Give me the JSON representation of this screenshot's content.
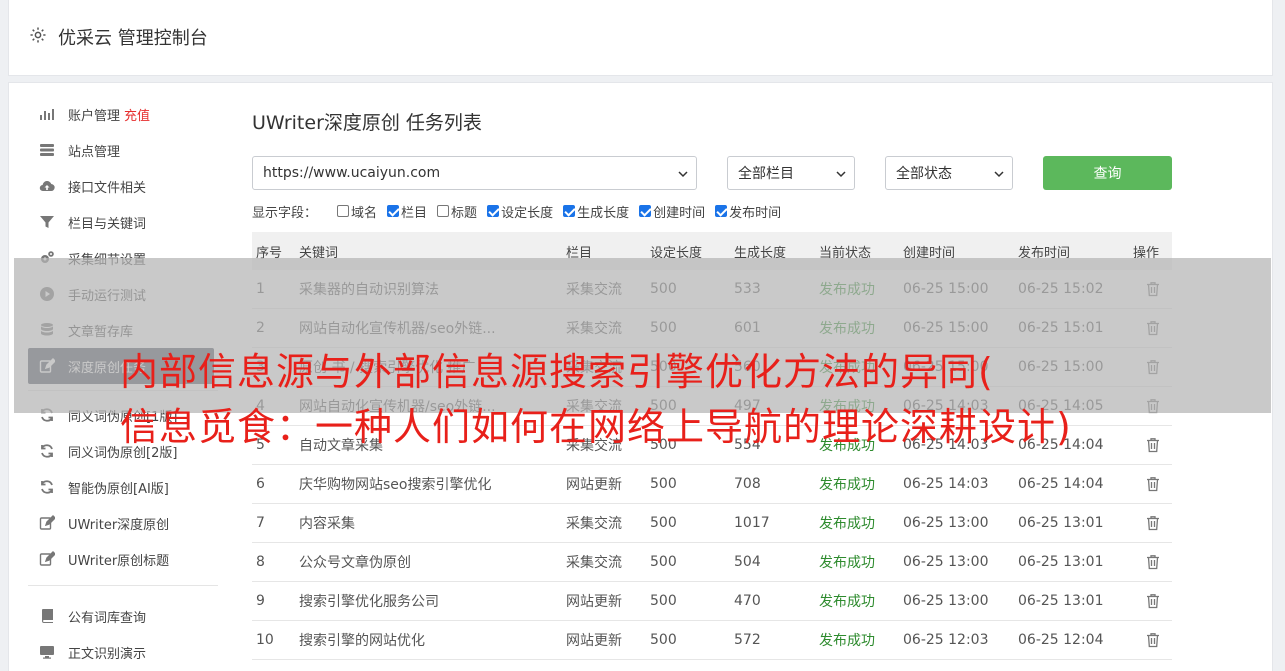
{
  "app": {
    "title": "优采云 管理控制台"
  },
  "sidebar": {
    "group1": [
      {
        "label": "账户管理",
        "extra": "充值",
        "icon": "bar-chart-icon"
      },
      {
        "label": "站点管理",
        "icon": "server-icon"
      },
      {
        "label": "接口文件相关",
        "icon": "cloud-upload-icon"
      },
      {
        "label": "栏目与关键词",
        "icon": "filter-icon"
      },
      {
        "label": "采集细节设置",
        "icon": "cogs-icon"
      },
      {
        "label": "手动运行测试",
        "icon": "play-circle-icon"
      },
      {
        "label": "文章暂存库",
        "icon": "database-icon"
      },
      {
        "label": "深度原创任务",
        "icon": "edit-icon",
        "active": true
      }
    ],
    "group2": [
      {
        "label": "同义词伪原创[1版]",
        "icon": "refresh-icon"
      },
      {
        "label": "同义词伪原创[2版]",
        "icon": "refresh-icon"
      },
      {
        "label": "智能伪原创[AI版]",
        "icon": "refresh-icon"
      },
      {
        "label": "UWriter深度原创",
        "icon": "edit-icon"
      },
      {
        "label": "UWriter原创标题",
        "icon": "edit-icon"
      }
    ],
    "group3": [
      {
        "label": "公有词库查询",
        "icon": "book-icon"
      },
      {
        "label": "正文识别演示",
        "icon": "monitor-icon"
      }
    ]
  },
  "main": {
    "title": "UWriter深度原创 任务列表",
    "site_select": "https://www.ucaiyun.com",
    "column_select": "全部栏目",
    "status_select": "全部状态",
    "query_label": "查询",
    "fields_label": "显示字段：",
    "fields": [
      {
        "label": "域名",
        "checked": false
      },
      {
        "label": "栏目",
        "checked": true
      },
      {
        "label": "标题",
        "checked": false
      },
      {
        "label": "设定长度",
        "checked": true
      },
      {
        "label": "生成长度",
        "checked": true
      },
      {
        "label": "创建时间",
        "checked": true
      },
      {
        "label": "发布时间",
        "checked": true
      }
    ],
    "columns": [
      "序号",
      "关键词",
      "栏目",
      "设定长度",
      "生成长度",
      "当前状态",
      "创建时间",
      "发布时间",
      "操作"
    ],
    "rows": [
      [
        "1",
        "采集器的自动识别算法",
        "采集交流",
        "500",
        "533",
        "发布成功",
        "06-25 15:00",
        "06-25 15:02"
      ],
      [
        "2",
        "网站自动化宣传机器/seo外链...",
        "采集交流",
        "500",
        "601",
        "发布成功",
        "06-25 15:00",
        "06-25 15:01"
      ],
      [
        "3",
        "原创 书 / 搜索引擎优化 推广",
        "采集交流",
        "500",
        "560",
        "发布成功",
        "06-25 15:00",
        "06-25 15:00"
      ],
      [
        "4",
        "网站自动化宣传机器/seo外链...",
        "采集交流",
        "500",
        "497",
        "发布成功",
        "06-25 14:03",
        "06-25 14:05"
      ],
      [
        "5",
        "自动文章采集",
        "采集交流",
        "500",
        "554",
        "发布成功",
        "06-25 14:03",
        "06-25 14:04"
      ],
      [
        "6",
        "庆华购物网站seo搜索引擎优化",
        "网站更新",
        "500",
        "708",
        "发布成功",
        "06-25 14:03",
        "06-25 14:04"
      ],
      [
        "7",
        "内容采集",
        "采集交流",
        "500",
        "1017",
        "发布成功",
        "06-25 13:00",
        "06-25 13:01"
      ],
      [
        "8",
        "公众号文章伪原创",
        "采集交流",
        "500",
        "504",
        "发布成功",
        "06-25 13:00",
        "06-25 13:01"
      ],
      [
        "9",
        "搜索引擎优化服务公司",
        "网站更新",
        "500",
        "470",
        "发布成功",
        "06-25 13:00",
        "06-25 13:01"
      ],
      [
        "10",
        "搜索引擎的网站优化",
        "网站更新",
        "500",
        "572",
        "发布成功",
        "06-25 12:03",
        "06-25 12:04"
      ]
    ]
  },
  "overlay": {
    "line1": "内部信息源与外部信息源搜索引擎优化方法的异同(",
    "line2": "信息觅食：一种人们如何在网络上导航的理论深耕设计)"
  },
  "colors": {
    "accent_green": "#5cb85c",
    "status_green": "#2e8b2e",
    "headline_red": "#e8201a",
    "active_bg": "#4c5460",
    "recharge_red": "#e62e2e"
  }
}
